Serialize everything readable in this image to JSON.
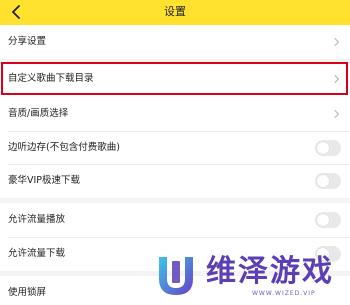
{
  "header": {
    "title": "设置",
    "back_icon": "chevron-left-icon",
    "background_color": "#ffe12e"
  },
  "settings": {
    "share": "分享设置",
    "custom_download_dir": "自定义歌曲下载目录",
    "audio_video_quality": "音质/画质选择",
    "listen_cache": "边听边存(不包含付费歌曲)",
    "vip_download": "豪华VIP极速下载",
    "allow_data_play": "允许流量播放",
    "allow_data_download": "允许流量下载",
    "lock_screen": "使用锁屏"
  },
  "toggles": {
    "listen_cache": false,
    "vip_download": false,
    "allow_data_play": false,
    "allow_data_download": false
  },
  "highlight": {
    "color": "#d9001b"
  },
  "watermark": {
    "title": "维泽游戏",
    "subtitle": "WWW.WIZED.VIP",
    "color": "#5b3fb4"
  }
}
